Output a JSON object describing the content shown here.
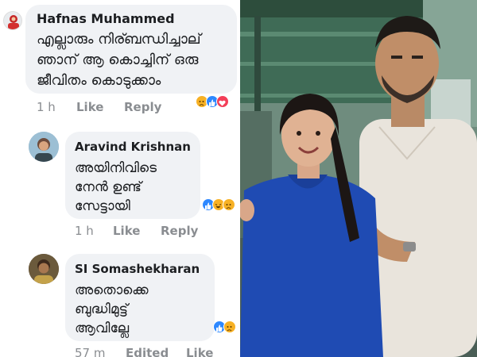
{
  "comments": [
    {
      "author": "Hafnas Muhammed",
      "lines": [
        "എല്ലാരും നിര്ബന്ധിച്ചാല്",
        "ഞാന് ആ കൊച്ചിന് ഒരു",
        "ജീവിതം കൊടുക്കാം"
      ],
      "time": "1 h",
      "like": "Like",
      "reply": "Reply",
      "reactions": [
        "sad",
        "like",
        "love"
      ]
    },
    {
      "author": "Aravind Krishnan",
      "lines": [
        "അയിനിവിടെ",
        "നേൻ ഉണ്ട്",
        "സേട്ടായി"
      ],
      "time": "1 h",
      "like": "Like",
      "reply": "Reply",
      "reactions": [
        "like",
        "haha",
        "sad"
      ]
    },
    {
      "author": "SI Somashekharan",
      "lines": [
        "അതൊക്കെ",
        "ബുദ്ധിമുട്ട്",
        "ആവില്ലേ"
      ],
      "time": "57 m",
      "edited": "Edited",
      "like": "Like",
      "reactions": [
        "like",
        "sad"
      ]
    }
  ],
  "colors": {
    "like": "#2d88ff",
    "love": "#f33e58",
    "sad": "#f7b125",
    "haha": "#f7b125",
    "bubble": "#f0f2f5",
    "meta": "#8a8d91"
  },
  "photo": {
    "icons": [
      "man-figure",
      "girl-figure"
    ]
  }
}
